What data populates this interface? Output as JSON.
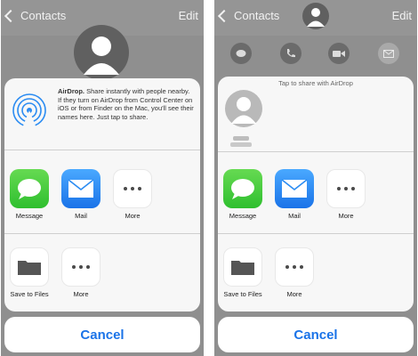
{
  "left_panel": {
    "nav": {
      "back_label": "Contacts",
      "edit_label": "Edit"
    },
    "airdrop": {
      "title": "AirDrop.",
      "description": "Share instantly with people nearby. If they turn on AirDrop from Control Center on iOS or from Finder on the Mac, you'll see their names here. Just tap to share."
    },
    "share_apps": [
      {
        "label": "Message",
        "icon": "message-icon"
      },
      {
        "label": "Mail",
        "icon": "mail-icon"
      },
      {
        "label": "More",
        "icon": "more-icon"
      }
    ],
    "actions": [
      {
        "label": "Save to Files",
        "icon": "folder-icon"
      },
      {
        "label": "More",
        "icon": "more-icon"
      }
    ],
    "cancel_label": "Cancel"
  },
  "right_panel": {
    "nav": {
      "back_label": "Contacts",
      "edit_label": "Edit"
    },
    "airdrop": {
      "tap_label": "Tap to share with AirDrop"
    },
    "share_apps": [
      {
        "label": "Message",
        "icon": "message-icon"
      },
      {
        "label": "Mail",
        "icon": "mail-icon"
      },
      {
        "label": "More",
        "icon": "more-icon"
      }
    ],
    "actions": [
      {
        "label": "Save to Files",
        "icon": "folder-icon"
      },
      {
        "label": "More",
        "icon": "more-icon"
      }
    ],
    "cancel_label": "Cancel"
  },
  "colors": {
    "accent": "#1a73e8",
    "message_green": "#3cc43c",
    "mail_blue": "#2b8cf2",
    "overlay": "#8f8f8f"
  }
}
